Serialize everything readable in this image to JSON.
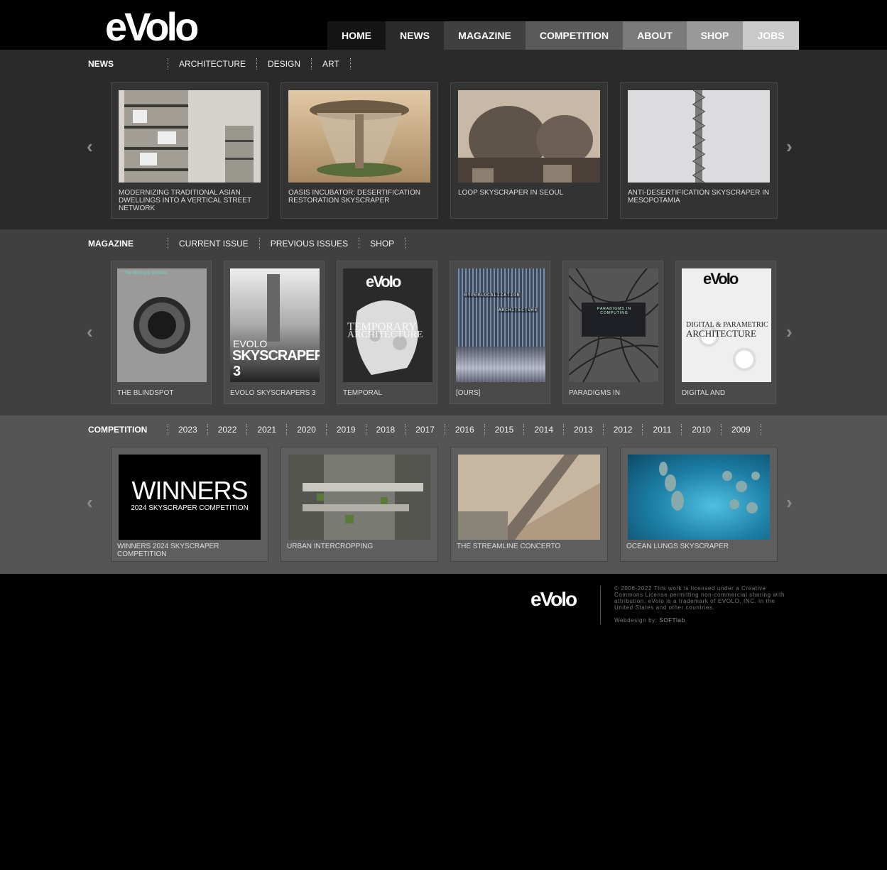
{
  "header": {
    "logo": "eVolo",
    "nav": [
      {
        "label": "HOME",
        "bg": "#141414"
      },
      {
        "label": "NEWS",
        "bg": "#2a2a2a"
      },
      {
        "label": "MAGAZINE",
        "bg": "#404040"
      },
      {
        "label": "COMPETITION",
        "bg": "#5a5a5a"
      },
      {
        "label": "ABOUT",
        "bg": "#7a7a7a"
      },
      {
        "label": "SHOP",
        "bg": "#999999"
      },
      {
        "label": "JOBS",
        "bg": "#c9c9c9"
      }
    ]
  },
  "news": {
    "title": "NEWS",
    "subnav": [
      "ARCHITECTURE",
      "DESIGN",
      "ART"
    ],
    "items": [
      "MODERNIZING TRADITIONAL ASIAN DWELLINGS INTO A VERTICAL STREET NETWORK",
      "OASIS INCUBATOR: DESERTIFICATION RESTORATION SKYSCRAPER",
      "LOOP SKYSCRAPER IN SEOUL",
      "ANTI-DESERTIFICATION SKYSCRAPER IN MESOPOTAMIA"
    ]
  },
  "magazine": {
    "title": "MAGAZINE",
    "subnav": [
      "CURRENT ISSUE",
      "PREVIOUS ISSUES",
      "SHOP"
    ],
    "items": [
      "THE BLINDSPOT",
      "EVOLO SKYSCRAPERS 3",
      "TEMPORAL",
      "[OURS]",
      "PARADIGMS IN",
      "DIGITAL AND"
    ],
    "cover_text": {
      "blindspot_top": "The Blindspot Initiative",
      "sky_evolo": "EVOLO",
      "sky_main": "SKYSCRAPERS",
      "sky_num": "3",
      "temporal_logo": "eVolo",
      "temporal_t1": "TEMPORARY",
      "temporal_t2": "ARCHITECTURE",
      "ours_t1": "HYPERLOCALIZATION",
      "ours_t2": "ARCHITECTURE",
      "paradigms_t": "PARADIGMS IN COMPUTING",
      "digital_logo": "eVolo",
      "digital_t1": "DIGITAL & PARAMETRIC",
      "digital_t2": "ARCHITECTURE"
    }
  },
  "competition": {
    "title": "COMPETITION",
    "years": [
      "2023",
      "2022",
      "2021",
      "2020",
      "2019",
      "2018",
      "2017",
      "2016",
      "2015",
      "2014",
      "2013",
      "2012",
      "2011",
      "2010",
      "2009"
    ],
    "items": [
      "WINNERS 2024 SKYSCRAPER COMPETITION",
      "URBAN INTERCROPPING",
      "THE STREAMLINE CONCERTO",
      "OCEAN LUNGS SKYSCRAPER"
    ],
    "winners_big": "WINNERS",
    "winners_small": "2024 SKYSCRAPER COMPETITION"
  },
  "footer": {
    "logo": "eVolo",
    "license": "© 2006-2022 This work is licensed under a Creative Commons License permitting non-commercial sharing with attribution. eVolo is a trademark of EVOLO, INC. in the United States and other countries.",
    "credit_label": "Webdesign by:",
    "credit_name": "SOFTlab"
  }
}
